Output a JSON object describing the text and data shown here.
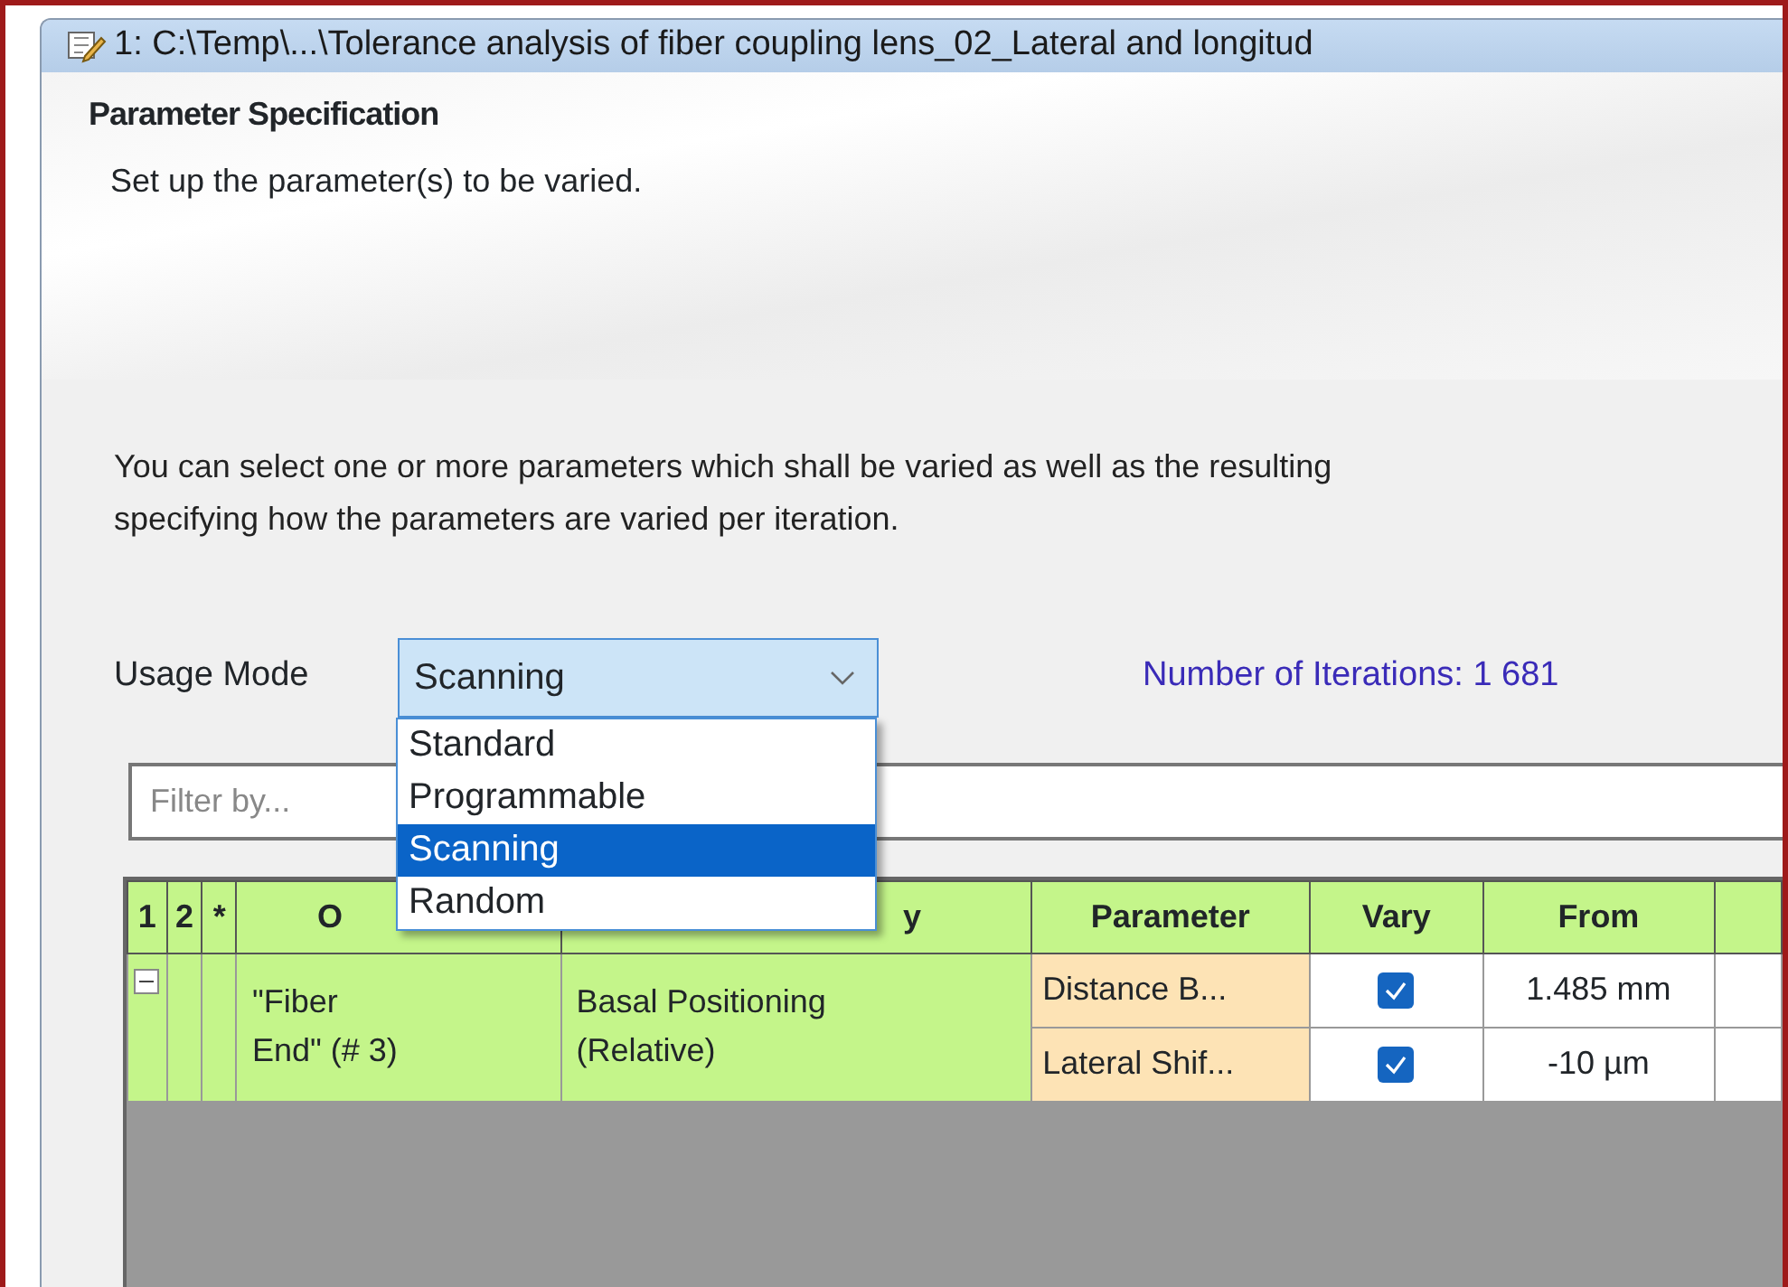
{
  "window": {
    "title": "1: C:\\Temp\\...\\Tolerance analysis of fiber coupling lens_02_Lateral and longitud"
  },
  "header": {
    "title": "Parameter Specification",
    "subtitle": "Set up the parameter(s) to be varied."
  },
  "description": [
    "You can select one or more parameters which shall be varied as well as the resulting",
    "specifying how the parameters are varied per iteration."
  ],
  "usage_mode": {
    "label": "Usage Mode",
    "value": "Scanning",
    "expanded": true,
    "options": [
      {
        "label": "Standard",
        "selected": false
      },
      {
        "label": "Programmable",
        "selected": false
      },
      {
        "label": "Scanning",
        "selected": true
      },
      {
        "label": "Random",
        "selected": false
      }
    ]
  },
  "iterations": "Number of Iterations: 1 681",
  "filter": {
    "placeholder": "Filter by..."
  },
  "table": {
    "columns": [
      "1",
      "2",
      "*",
      "O",
      "y",
      "Parameter",
      "Vary",
      "From"
    ],
    "groups": [
      {
        "expanded": true,
        "object": "\"Fiber End\" (# 3)",
        "category": "Basal Positioning (Relative)",
        "rows": [
          {
            "parameter": "Distance B...",
            "vary": true,
            "from": "1.485 mm"
          },
          {
            "parameter": "Lateral Shif...",
            "vary": true,
            "from": "-10 µm"
          }
        ]
      }
    ]
  }
}
